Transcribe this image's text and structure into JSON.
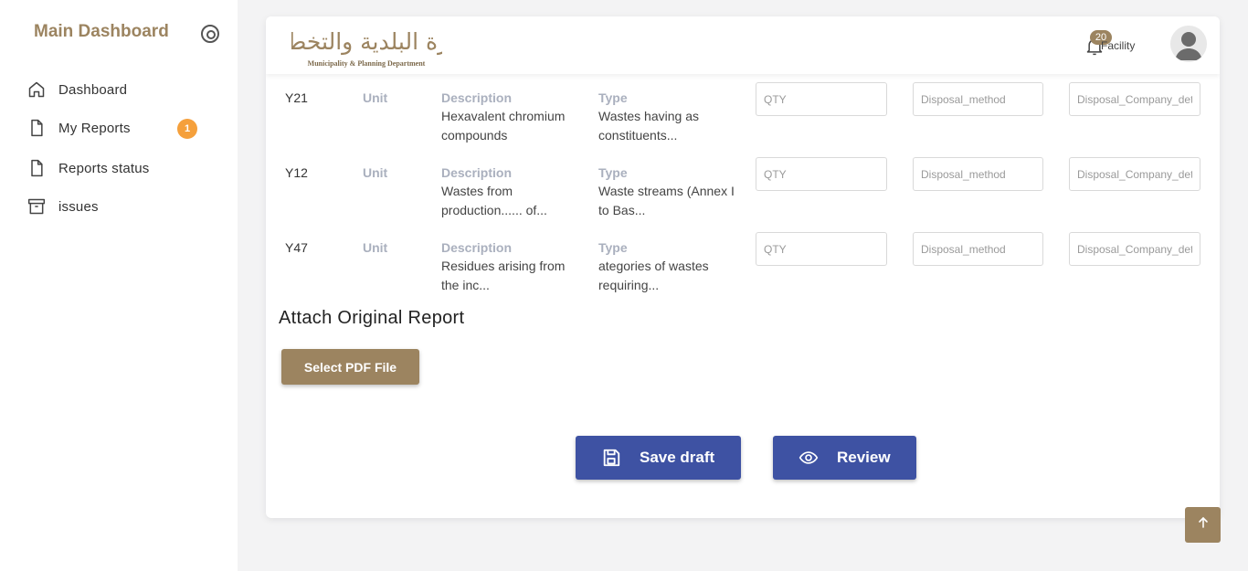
{
  "sidebar": {
    "title": "Main Dashboard",
    "items": [
      {
        "label": "Dashboard",
        "icon": "home-icon"
      },
      {
        "label": "My Reports",
        "icon": "file-icon",
        "badge": "1"
      },
      {
        "label": "Reports status",
        "icon": "file-icon"
      },
      {
        "label": "issues",
        "icon": "archive-icon"
      }
    ]
  },
  "header": {
    "logo_arabic": "دائرة البلدية والتخطيط",
    "logo_english": "Municipality & Planning Department",
    "notifications": "20",
    "user_label": "Facility"
  },
  "table": {
    "unit_label": "Unit",
    "description_label": "Description",
    "type_label": "Type",
    "qty_placeholder": "QTY",
    "disposal_method_placeholder": "Disposal_method",
    "disposal_company_placeholder": "Disposal_Company_details",
    "rows": [
      {
        "code": "Y21",
        "description": "Hexavalent chromium compounds",
        "type": "Wastes having as constituents..."
      },
      {
        "code": "Y12",
        "description": "Wastes from production...... of...",
        "type": "Waste streams (Annex I to Bas..."
      },
      {
        "code": "Y47",
        "description": "Residues arising from the inc...",
        "type": "ategories of wastes requiring..."
      }
    ]
  },
  "attach": {
    "title": "Attach Original Report",
    "button": "Select PDF File"
  },
  "actions": {
    "save_draft": "Save draft",
    "review": "Review"
  },
  "colors": {
    "brand": "#9c8460",
    "primary": "#3e52a3",
    "badge": "#f5a03c"
  }
}
